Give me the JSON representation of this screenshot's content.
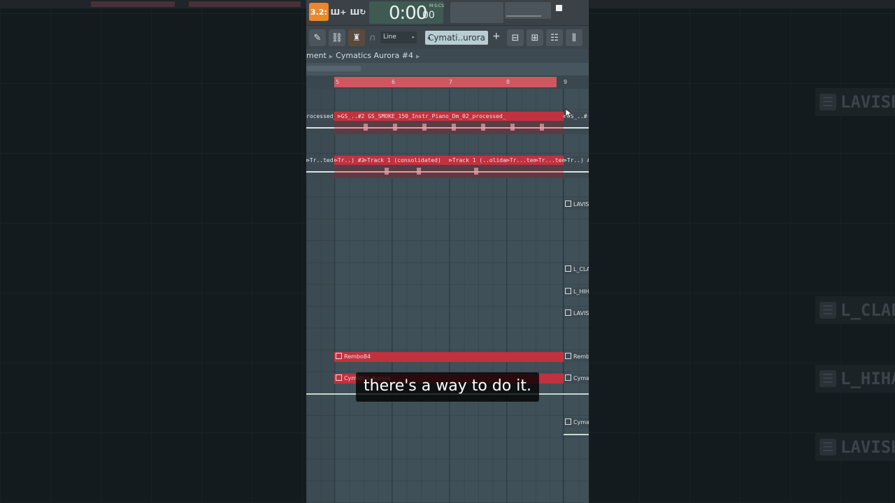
{
  "transport": {
    "time_big": "0:00",
    "time_small": "00",
    "time_format": "M:S:CS",
    "snap_mode": "Line",
    "pattern_name": "Cymati..urora",
    "tempo_mode_label": "3.2:"
  },
  "breadcrumb": {
    "parent": "ment",
    "current": "Cymatics Aurora #4"
  },
  "ruler": {
    "bars": [
      "5",
      "6",
      "7",
      "8",
      "9"
    ]
  },
  "tracks": {
    "row1": {
      "left_label": "rocessed_",
      "main_label": "GS_..#2  GS_SMOKE_150_Instr_Piano_Dm_02_processed_",
      "right_label": "GS_..#"
    },
    "row2": {
      "left_label": "Tr..ted)",
      "seg1": "Tr..) #2",
      "seg2": "Track 1 (consolidated)",
      "seg3": "Track 1 (..olidated)",
      "seg4": "Tr...ted)",
      "seg5": "Tr...ted)",
      "right_label": "Tr..) #"
    },
    "pattern_clips": [
      {
        "label": "LAVISH"
      },
      {
        "label": "L_CLAP"
      },
      {
        "label": "L_HIHA"
      },
      {
        "label": "LAVISH"
      },
      {
        "label": "Rembo84"
      },
      {
        "label": "Rembo"
      },
      {
        "label": "Cymatics Aurora"
      },
      {
        "label": "Cymati"
      },
      {
        "label": "Cymati"
      }
    ]
  },
  "background_labels": [
    "LAVISH",
    "L_CLAP",
    "L_HIHA",
    "LAVISH"
  ],
  "subtitle": "there's a way to do it.",
  "colors": {
    "accent": "#e8892e",
    "clip_red": "#c1323e",
    "playlist_bg": "#405059",
    "loop_region": "#d0575f"
  }
}
